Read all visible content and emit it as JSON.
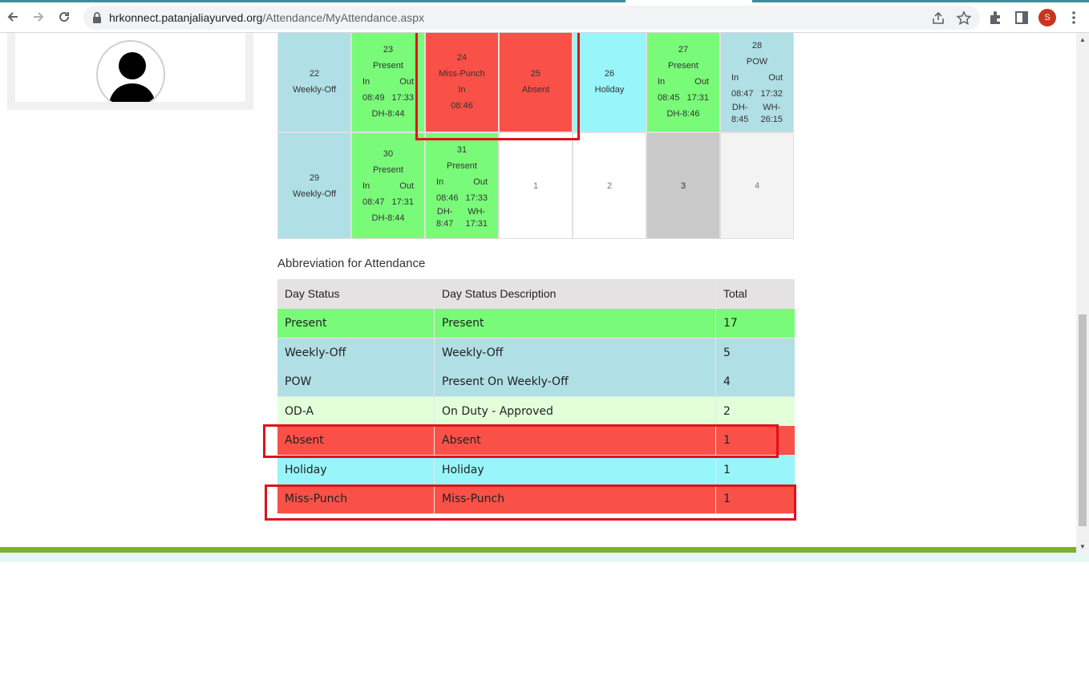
{
  "browser": {
    "url_host": "hrkonnect.patanjaliayurved.org",
    "url_path": "/Attendance/MyAttendance.aspx",
    "profile_initial": "S"
  },
  "calendar": {
    "row1": [
      {
        "day": "22",
        "status": "Weekly-Off"
      },
      {
        "day": "23",
        "status": "Present",
        "in_label": "In",
        "out_label": "Out",
        "in": "08:49",
        "out": "17:33",
        "extra": "DH-8:44"
      },
      {
        "day": "24",
        "status": "Miss-Punch",
        "in_label": "In",
        "in": "08:46"
      },
      {
        "day": "25",
        "status": "Absent"
      },
      {
        "day": "26",
        "status": "Holiday"
      },
      {
        "day": "27",
        "status": "Present",
        "in_label": "In",
        "out_label": "Out",
        "in": "08:45",
        "out": "17:31",
        "extra": "DH-8:46"
      },
      {
        "day": "28",
        "status": "POW",
        "in_label": "In",
        "out_label": "Out",
        "in": "08:47",
        "out": "17:32",
        "dh_label": "DH-",
        "dh": "8:45",
        "wh_label": "WH-",
        "wh": "26:15"
      }
    ],
    "row2": [
      {
        "day": "29",
        "status": "Weekly-Off"
      },
      {
        "day": "30",
        "status": "Present",
        "in_label": "In",
        "out_label": "Out",
        "in": "08:47",
        "out": "17:31",
        "extra": "DH-8:44"
      },
      {
        "day": "31",
        "status": "Present",
        "in_label": "In",
        "out_label": "Out",
        "in": "08:46",
        "out": "17:33",
        "dh_label": "DH-",
        "dh": "8:47",
        "wh_label": "WH-",
        "wh": "17:31"
      },
      {
        "day": "1"
      },
      {
        "day": "2"
      },
      {
        "day": "3"
      },
      {
        "day": "4"
      }
    ]
  },
  "legend": {
    "title": "Abbreviation for Attendance",
    "headers": [
      "Day Status",
      "Day Status Description",
      "Total"
    ],
    "rows": [
      {
        "status": "Present",
        "description": "Present",
        "total": "17",
        "color": "#79fb79"
      },
      {
        "status": "Weekly-Off",
        "description": "Weekly-Off",
        "total": "5",
        "color": "#b0dfe5"
      },
      {
        "status": "POW",
        "description": "Present On Weekly-Off",
        "total": "4",
        "color": "#b0dfe5"
      },
      {
        "status": "OD-A",
        "description": "On Duty - Approved",
        "total": "2",
        "color": "#e3ffda"
      },
      {
        "status": "Absent",
        "description": "Absent",
        "total": "1",
        "color": "#f95148"
      },
      {
        "status": "Holiday",
        "description": "Holiday",
        "total": "1",
        "color": "#98f5fa"
      },
      {
        "status": "Miss-Punch",
        "description": "Miss-Punch",
        "total": "1",
        "color": "#f95148"
      }
    ]
  }
}
